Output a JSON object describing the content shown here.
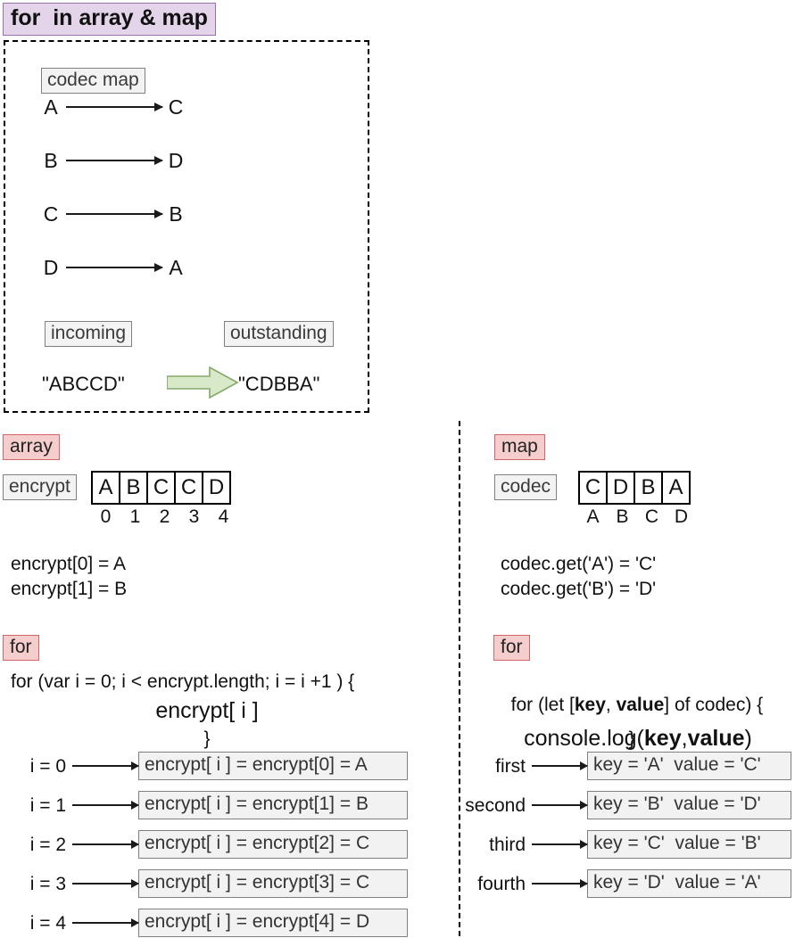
{
  "title": "for  in array & map",
  "diagram": {
    "codec_map_label": "codec map",
    "mappings": [
      {
        "from": "A",
        "to": "C"
      },
      {
        "from": "B",
        "to": "D"
      },
      {
        "from": "C",
        "to": "B"
      },
      {
        "from": "D",
        "to": "A"
      }
    ],
    "incoming_label": "incoming",
    "outstanding_label": "outstanding",
    "incoming_value": "\"ABCCD\"",
    "outstanding_value": "\"CDBBA\"",
    "arrow_color": "#d7e9c9"
  },
  "left": {
    "section_badge": "array",
    "var_label": "encrypt",
    "cells": [
      "A",
      "B",
      "C",
      "C",
      "D"
    ],
    "indices": [
      "0",
      "1",
      "2",
      "3",
      "4"
    ],
    "examples": [
      "encrypt[0] = A",
      "encrypt[1] = B"
    ],
    "for_badge": "for",
    "code": {
      "line1": "for (var i = 0; i < encrypt.length; i = i +1 ) {",
      "line2": "encrypt[ i ]",
      "line3": "}"
    },
    "iterations": [
      {
        "label": "i = 0",
        "result": "encrypt[ i ] = encrypt[0] = A"
      },
      {
        "label": "i = 1",
        "result": "encrypt[ i ] = encrypt[1] = B"
      },
      {
        "label": "i = 2",
        "result": "encrypt[ i ] = encrypt[2] = C"
      },
      {
        "label": "i = 3",
        "result": "encrypt[ i ] = encrypt[3] = C"
      },
      {
        "label": "i = 4",
        "result": "encrypt[ i ] = encrypt[4] = D"
      }
    ]
  },
  "right": {
    "section_badge": "map",
    "var_label": "codec",
    "cells": [
      "C",
      "D",
      "B",
      "A"
    ],
    "indices": [
      "A",
      "B",
      "C",
      "D"
    ],
    "examples": [
      "codec.get('A') = 'C'",
      "codec.get('B') = 'D'"
    ],
    "for_badge": "for",
    "code": {
      "line1_pre": "for (let [",
      "line1_key": "key",
      "line1_mid": ", ",
      "line1_value": "value",
      "line1_post": "] of codec) {",
      "line2_pre": "console.log(",
      "line2_key": "key",
      "line2_mid": ",",
      "line2_value": "value",
      "line2_post": ")",
      "line3": "}"
    },
    "iterations": [
      {
        "label": "first",
        "result": "key = 'A'  value = 'C'"
      },
      {
        "label": "second",
        "result": "key = 'B'  value = 'D'"
      },
      {
        "label": "third",
        "result": "key = 'C'  value = 'B'"
      },
      {
        "label": "fourth",
        "result": "key = 'D'  value = 'A'"
      }
    ]
  },
  "colors": {
    "title_badge_bg": "#e3d4ea",
    "title_badge_border": "#9a72ab",
    "pink_badge_bg": "#f5cdcd",
    "pink_badge_border": "#d06666",
    "grey_label_bg": "#f3f3f3",
    "grey_label_border": "#808080"
  }
}
